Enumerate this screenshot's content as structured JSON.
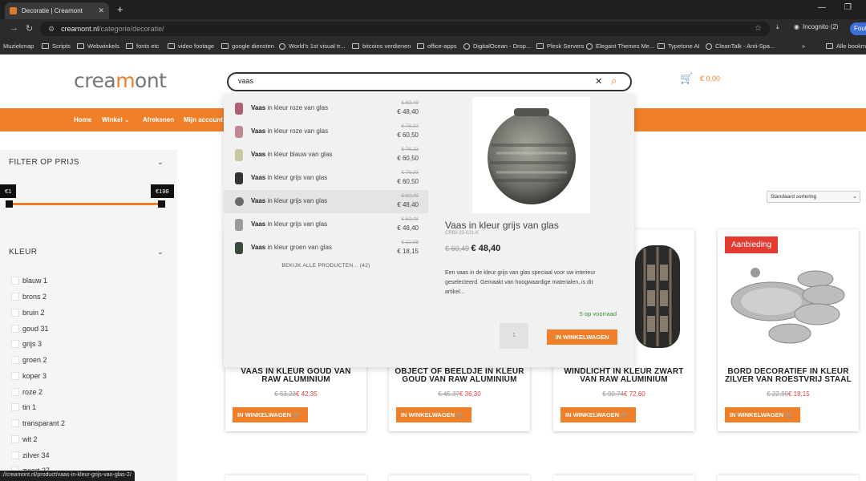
{
  "browser": {
    "tab_title": "Decoratie | Creamont",
    "url_host": "creamont.nl",
    "url_path": "/categorie/decoratie/",
    "incognito": "Incognito (2)",
    "error_btn": "Fout",
    "bookmarks": [
      "Muziekmap",
      "Scripts",
      "Webwinkels",
      "fonts etc",
      "video footage",
      "google diensten",
      "World's 1st visual tr...",
      "bitcoins verdienen",
      "office-apps",
      "DigitalOcean - Drop...",
      "Plesk Servers",
      "Elegant Themes Me...",
      "Typetone AI",
      "CleanTalk - Anti-Spa...",
      "Alle bookmarks"
    ],
    "status_url": "://creamont.nl/product/vaas-in-kleur-grijs-van-glas-2/"
  },
  "site": {
    "logo_pre": "crea",
    "logo_o": "m",
    "logo_post": "ont",
    "cart_total": "€ 0,00",
    "nav": [
      "Home",
      "Winkel ⌄",
      "Afrekenen",
      "Mijn account"
    ]
  },
  "search": {
    "query": "vaas",
    "results": [
      {
        "name_rest": " in kleur roze van glas",
        "old": "€ 60,49",
        "new": "€ 48,40",
        "color": "#b06070"
      },
      {
        "name_rest": " in kleur roze van glas",
        "old": "€ 76,22",
        "new": "€ 60,50",
        "color": "#c08890"
      },
      {
        "name_rest": " in kleur blauw van glas",
        "old": "€ 76,22",
        "new": "€ 60,50",
        "color": "#c8c8a0"
      },
      {
        "name_rest": " in kleur grijs van glas",
        "old": "€ 76,22",
        "new": "€ 60,50",
        "color": "#333333"
      },
      {
        "name_rest": " in kleur grijs van glas",
        "old": "€ 60,49",
        "new": "€ 48,40",
        "color": "#6a6a6a"
      },
      {
        "name_rest": " in kleur grijs van glas",
        "old": "€ 60,49",
        "new": "€ 48,40",
        "color": "#9a9a9a"
      },
      {
        "name_rest": " in kleur groen van glas",
        "old": "€ 22,98",
        "new": "€ 18,15",
        "color": "#3a4a3a"
      }
    ],
    "result_bold": "Vaas",
    "view_all": "BEKIJK ALLE PRODUCTEN... (42)",
    "detail": {
      "title": "Vaas in kleur grijs van glas",
      "sku": "CR93-23-021-K",
      "old": "€ 60,49",
      "new": "€ 48,40",
      "desc": "Een vaas in de kleur grijs van glas speciaal voor uw interieur geselecteerd. Gemaakt van hoogwaardige materialen, is dit artikel...",
      "stock": "5 op voorraad",
      "qty": "1",
      "add": "IN WINKELWAGEN"
    }
  },
  "sidebar": {
    "price_title": "FILTER OP PRIJS",
    "min": "€1",
    "max": "€198",
    "color_title": "KLEUR",
    "colors": [
      "blauw 1",
      "brons 2",
      "bruin 2",
      "goud 31",
      "grijs 3",
      "groen 2",
      "koper 3",
      "roze 2",
      "tin 1",
      "transparant 2",
      "wit 2",
      "zilver 34",
      "zwart 27"
    ]
  },
  "sort": "Standaard sortering",
  "products": [
    {
      "title": "VAAS IN KLEUR GOUD VAN RAW ALUMINIUM",
      "old": "€ 53,23",
      "new": "€ 42,35",
      "btn": "IN WINKELWAGEN"
    },
    {
      "title": "OBJECT OF BEELDJE IN KLEUR GOUD VAN RAW ALUMINIUM",
      "old": "€ 45,37",
      "new": "€ 36,30",
      "btn": "IN WINKELWAGEN"
    },
    {
      "title": "WINDLICHT IN KLEUR ZWART VAN RAW ALUMINIUM",
      "old": "€ 90,74",
      "new": "€ 72,60",
      "btn": "IN WINKELWAGEN"
    },
    {
      "title": "BORD DECORATIEF IN KLEUR ZILVER VAN ROESTVRIJ STAAL",
      "old": "€ 22,99",
      "new": "€ 18,15",
      "btn": "IN WINKELWAGEN",
      "badge": "Aanbieding"
    }
  ]
}
